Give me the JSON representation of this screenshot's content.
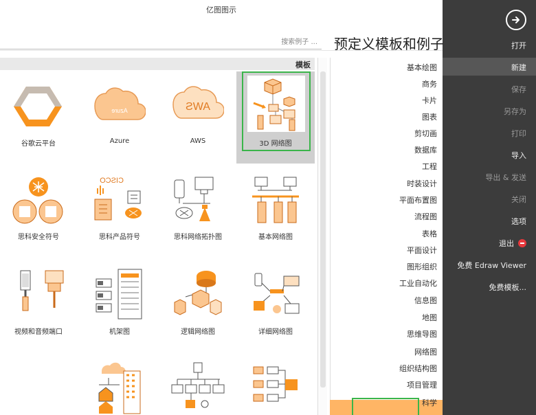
{
  "app_title": "亿图图示",
  "page_heading": "预定义模板和例子",
  "search_placeholder": "搜索例子 ...",
  "templates_header": "模板",
  "nav": {
    "items": [
      "打开",
      "新建",
      "保存",
      "另存为",
      "打印",
      "导入",
      "导出 & 发送",
      "关闭",
      "选项",
      "退出",
      "免费 Edraw Viewer",
      "免费模板..."
    ],
    "selected": "新建"
  },
  "categories": {
    "items": [
      "基本绘图",
      "商务",
      "卡片",
      "图表",
      "剪切画",
      "数据库",
      "工程",
      "时装设计",
      "平面布置图",
      "流程图",
      "表格",
      "平面设计",
      "图形组织",
      "工业自动化",
      "信息图",
      "地图",
      "思维导图",
      "网络图",
      "组织结构图",
      "项目管理",
      "科学"
    ],
    "selected": "网络图"
  },
  "templates": [
    {
      "label": "3D 网络图",
      "icon": "3d-network-thumb",
      "selected": true
    },
    {
      "label": "AWS",
      "icon": "aws-cloud-thumb"
    },
    {
      "label": "Azure",
      "icon": "azure-cloud-thumb"
    },
    {
      "label": "谷歌云平台",
      "icon": "google-cloud-thumb"
    },
    {
      "label": "基本网络图",
      "icon": "basic-network-thumb"
    },
    {
      "label": "思科网络拓扑图",
      "icon": "cisco-topology-thumb"
    },
    {
      "label": "思科产品符号",
      "icon": "cisco-products-thumb"
    },
    {
      "label": "思科安全符号",
      "icon": "cisco-security-thumb"
    },
    {
      "label": "详细网络图",
      "icon": "detailed-network-thumb"
    },
    {
      "label": "逻辑网络图",
      "icon": "logical-network-thumb"
    },
    {
      "label": "机架图",
      "icon": "rack-diagram-thumb"
    },
    {
      "label": "视频和音频端口",
      "icon": "av-ports-thumb"
    },
    {
      "label": "",
      "icon": "hierarchy-thumb"
    },
    {
      "label": "",
      "icon": "org-network-thumb"
    },
    {
      "label": "",
      "icon": "building-network-thumb"
    }
  ],
  "thumb_text": {
    "aws": "AWS",
    "azure": "Azure",
    "cisco": "CISCO"
  },
  "colors": {
    "accent": "#f7931e",
    "accent_light": "#ffb565",
    "nav_bg": "#3c3c3c",
    "selection_outline": "#3ab54a"
  }
}
